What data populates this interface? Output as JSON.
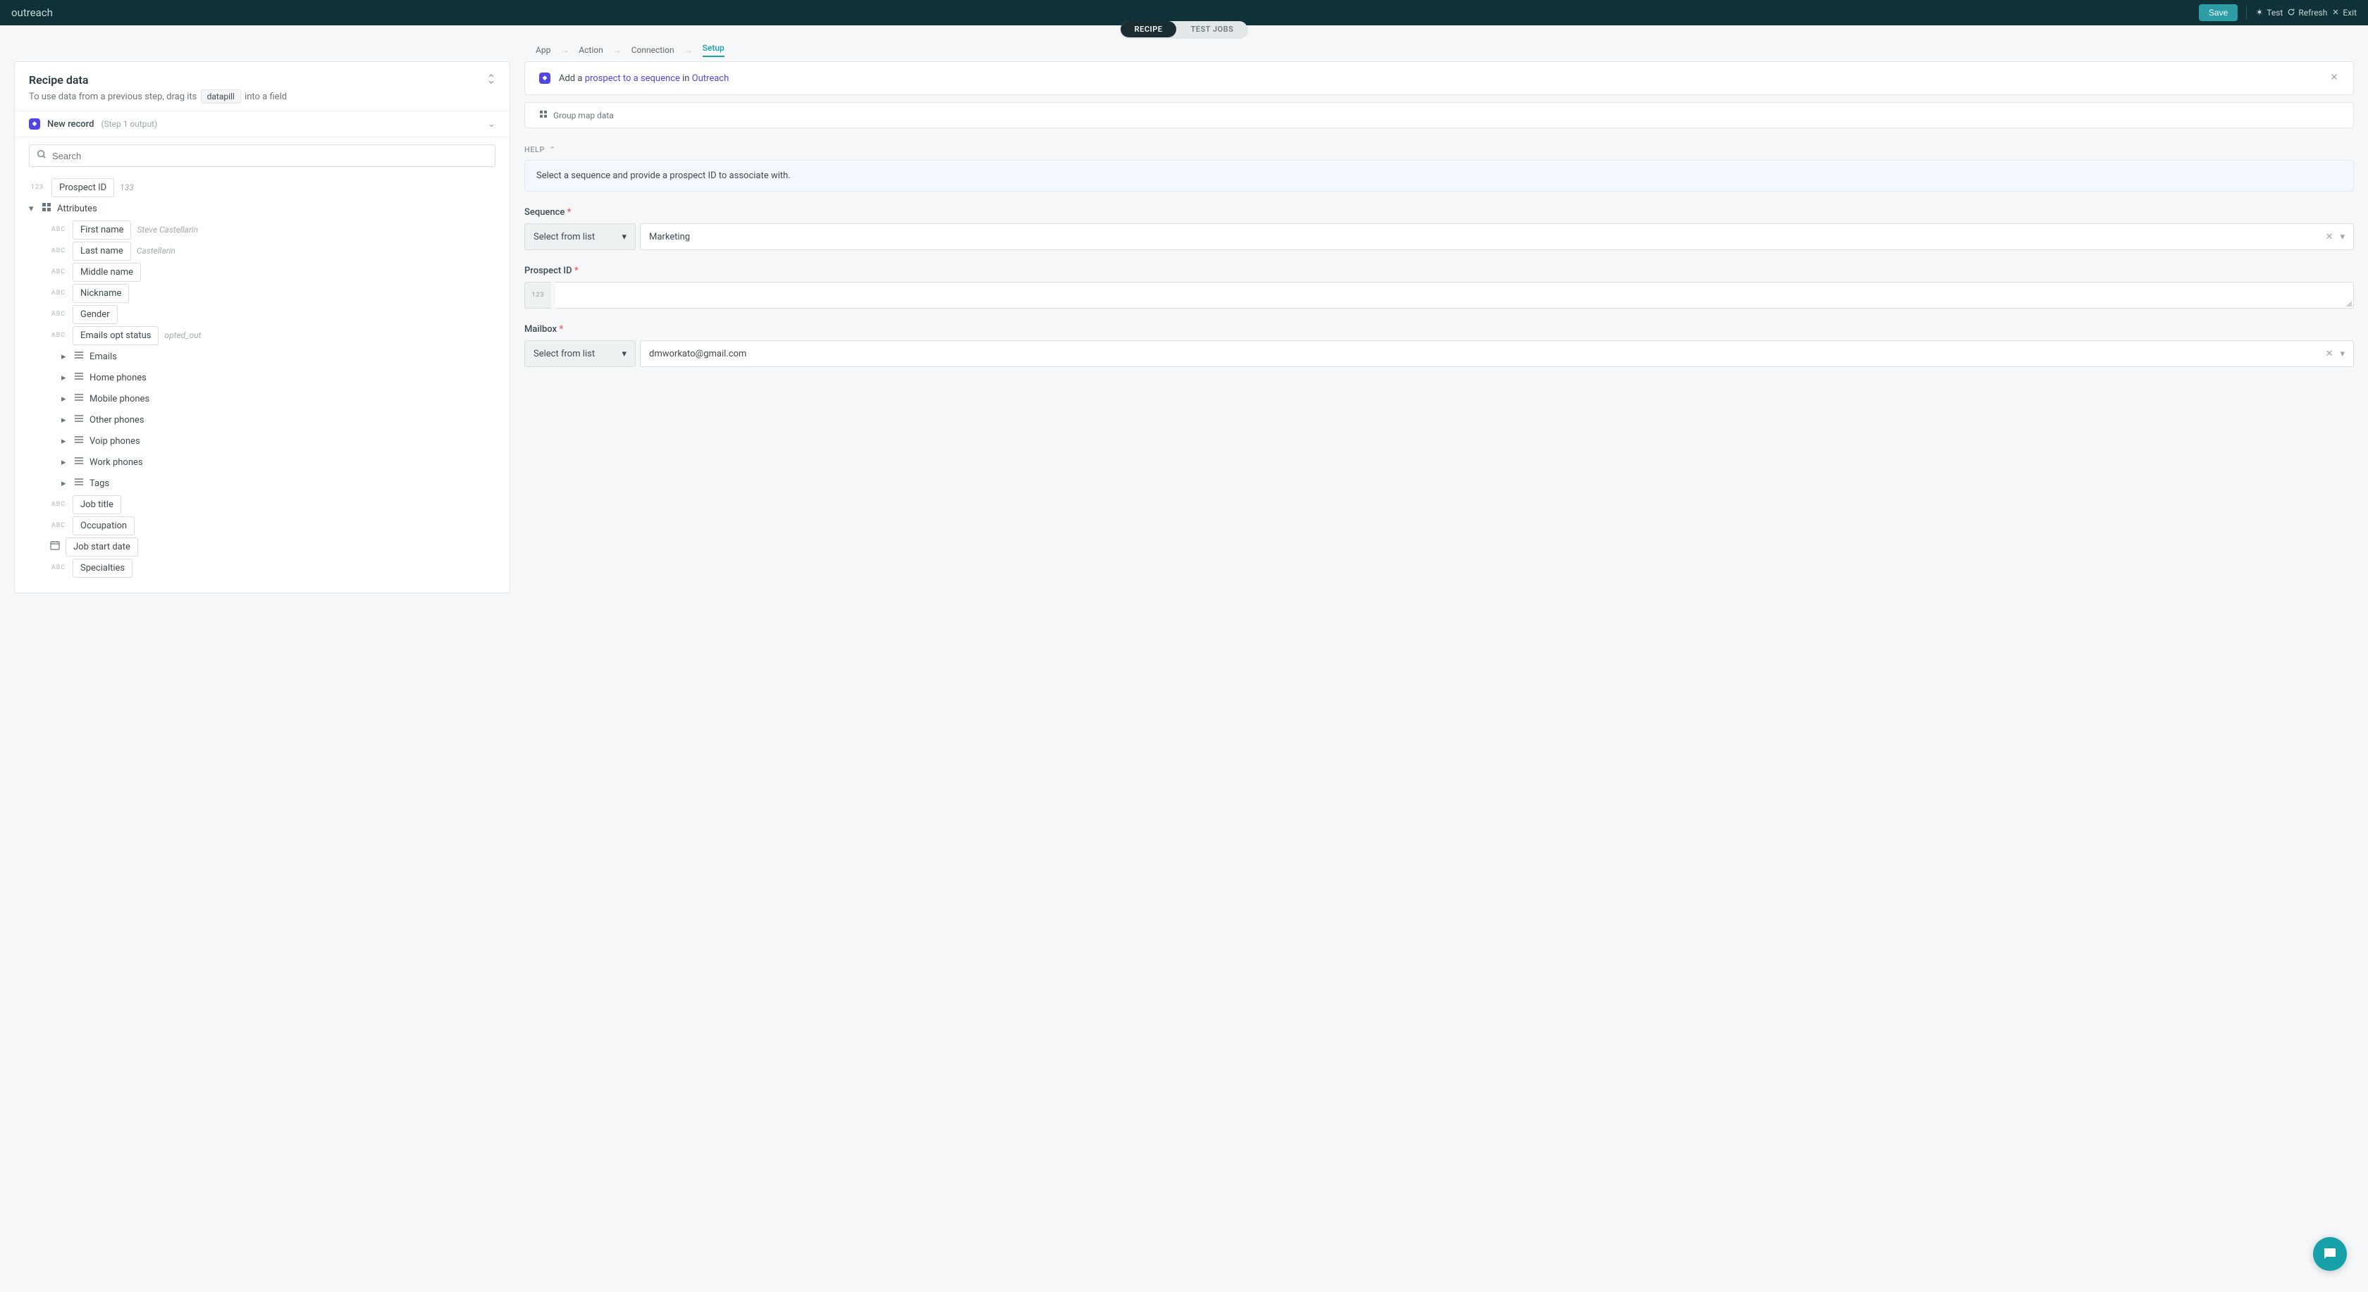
{
  "header": {
    "title": "outreach",
    "save": "Save",
    "test": "Test",
    "refresh": "Refresh",
    "exit": "Exit"
  },
  "pills": {
    "recipe": "RECIPE",
    "test_jobs": "TEST JOBS"
  },
  "steps": {
    "app": "App",
    "action": "Action",
    "connection": "Connection",
    "setup": "Setup"
  },
  "left": {
    "title": "Recipe data",
    "sub_pre": "To use data from a previous step, drag its",
    "datapill": "datapill",
    "sub_post": "into a field",
    "step_label": "New record",
    "step_meta": "(Step 1 output)",
    "search_placeholder": "Search",
    "prospect_id_label": "Prospect ID",
    "prospect_id_sample": "133",
    "attributes_label": "Attributes",
    "fields": [
      {
        "type": "abc",
        "label": "First name",
        "sample": "Steve Castellarin"
      },
      {
        "type": "abc",
        "label": "Last name",
        "sample": "Castellarin"
      },
      {
        "type": "abc",
        "label": "Middle name",
        "sample": ""
      },
      {
        "type": "abc",
        "label": "Nickname",
        "sample": ""
      },
      {
        "type": "abc",
        "label": "Gender",
        "sample": ""
      },
      {
        "type": "abc",
        "label": "Emails opt status",
        "sample": "opted_out"
      }
    ],
    "lists": [
      "Emails",
      "Home phones",
      "Mobile phones",
      "Other phones",
      "Voip phones",
      "Work phones",
      "Tags"
    ],
    "more_fields": [
      {
        "type": "abc",
        "label": "Job title"
      },
      {
        "type": "abc",
        "label": "Occupation"
      },
      {
        "type": "cal",
        "label": "Job start date"
      },
      {
        "type": "abc",
        "label": "Specialties"
      }
    ]
  },
  "right": {
    "action_pre": "Add a",
    "action_link1": "prospect to a sequence",
    "action_mid": "in",
    "action_link2": "Outreach",
    "map_label": "Group map data",
    "help_label": "HELP",
    "help_text": "Select a sequence and provide a prospect ID to associate with.",
    "seq_label": "Sequence",
    "select_from_list": "Select from list",
    "seq_value": "Marketing",
    "pid_label": "Prospect ID",
    "mailbox_label": "Mailbox",
    "mailbox_value": "dmworkato@gmail.com"
  }
}
